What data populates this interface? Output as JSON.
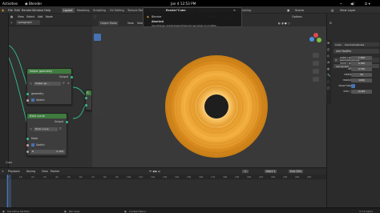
{
  "system_bar": {
    "activities": "Activities",
    "app": "Blender",
    "clock": "Jan 4  12:53 PM",
    "window_title": "spirograph.blend"
  },
  "menubar": {
    "menus": [
      "File",
      "Edit",
      "Render",
      "Window",
      "Help"
    ],
    "workspaces": [
      "Layout",
      "Modeling",
      "Sculpting",
      "UV Editing",
      "Texture Paint",
      "Shading",
      "Animation",
      "Rendering",
      "Compositing",
      "Geometry Nodes",
      "Scripting"
    ],
    "active_workspace": "Layout",
    "scene_label": "Scene",
    "view_layer_label": "View Layer"
  },
  "node_editor": {
    "header_menus": [
      "View",
      "Select",
      "Add",
      "Node"
    ],
    "node_tree_name": "spirograph",
    "label_bottom": "Cube",
    "nodes": [
      {
        "title": "helper geometry",
        "output_label": "Output",
        "inner_name": "helper ge...",
        "geometry_label": "geometry",
        "switch_label": "Switch"
      },
      {
        "title": "thick curve",
        "output_label": "Output",
        "inner_name": "thick curve",
        "mesh_label": "Mesh",
        "switch_label": "Switch",
        "value_label": "R",
        "value": "0.100"
      }
    ]
  },
  "viewport": {
    "mode": "Object Mode",
    "header_menus": [
      "View",
      "Select",
      "Add",
      "Object"
    ],
    "transform": "Global",
    "options": "Options",
    "ring_color": "#e8a030",
    "bg_color": "#393939"
  },
  "notification": {
    "title": "Render\"Cube",
    "app_name": "Blender",
    "heading": "Aborted",
    "message": "Use Strange context-based Prerecord see addon to modifier..."
  },
  "properties": {
    "object_name": "Cube",
    "modifier_tab": "GeometryNodes",
    "modifier_header": "Add Modifier",
    "group_name": "spirograph",
    "fields": [
      {
        "label": "outer radius",
        "value": "1.000"
      },
      {
        "label": "inner radius",
        "value": "0.350"
      },
      {
        "label": "offset",
        "value": "0.750"
      },
      {
        "label": "rotations",
        "value": "34"
      },
      {
        "label": "resolution",
        "value": "1000"
      },
      {
        "label": "show helpers",
        "value": ""
      },
      {
        "label": "wire / rad",
        "value": "0.015"
      }
    ]
  },
  "timeline": {
    "menus": [
      "Playback",
      "Keying",
      "View",
      "Marker"
    ],
    "ticks": [
      "0",
      "10",
      "20",
      "30",
      "40",
      "50",
      "60",
      "70",
      "80",
      "90",
      "100",
      "110",
      "120",
      "130",
      "140",
      "150",
      "160",
      "170",
      "180",
      "190",
      "200",
      "210",
      "220",
      "230",
      "240",
      "250"
    ],
    "current_frame": "1",
    "start_label": "Start",
    "start": "1",
    "end_label": "End",
    "end": "250"
  },
  "status": {
    "left": "Set active Modifier",
    "middle1": "Pan View",
    "middle2": "Context Menu",
    "right": "3.3.0 Alpha"
  },
  "colors": {
    "accent": "#4772b3",
    "node_header": "#3f7a3f",
    "link": "#32c08a",
    "ring": "#e8a030"
  }
}
